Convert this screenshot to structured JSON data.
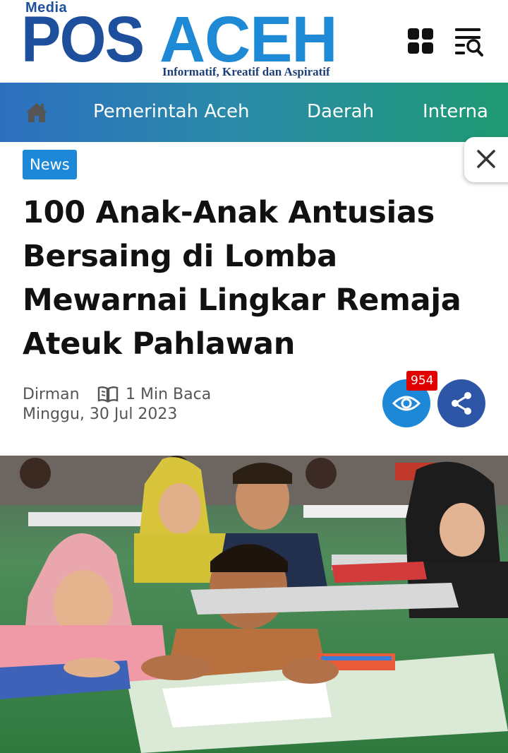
{
  "site": {
    "logo_media": "Media",
    "logo_pos": "POS",
    "logo_aceh": "ACEH",
    "tagline": "Informatif, Kreatif dan Aspiratif"
  },
  "header": {
    "grid_icon": "grid-icon",
    "search_menu_icon": "search-menu-icon"
  },
  "nav": {
    "home_icon": "home-icon",
    "items": [
      {
        "label": "Pemerintah Aceh"
      },
      {
        "label": "Daerah"
      },
      {
        "label": "Interna"
      }
    ]
  },
  "article": {
    "category": "News",
    "title": "100 Anak-Anak Antusias Bersaing di Lomba Mewarnai Lingkar Remaja Ateuk Pahlawan",
    "author": "Dirman",
    "read_time": "1 Min Baca",
    "date": "Minggu, 30 Jul 2023",
    "views": "954"
  },
  "colors": {
    "brand_dark_blue": "#1d4f9c",
    "brand_light_blue": "#1e88d8",
    "nav_gradient_start": "#2c6fbf",
    "nav_gradient_end": "#1f9a72",
    "share_button": "#2d57a6",
    "view_badge": "#e00000"
  }
}
